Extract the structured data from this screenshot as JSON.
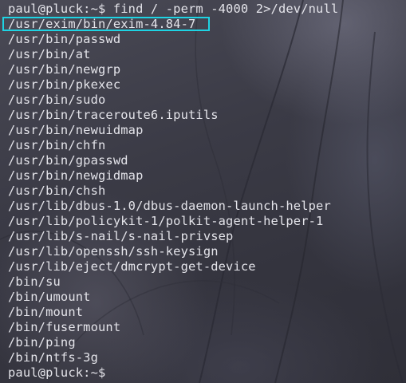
{
  "terminal": {
    "command_line": "paul@pluck:~$ find / -perm -4000 2>/dev/null",
    "highlighted_result": "/usr/exim/bin/exim-4.84-7",
    "results": [
      "/usr/bin/passwd",
      "/usr/bin/at",
      "/usr/bin/newgrp",
      "/usr/bin/pkexec",
      "/usr/bin/sudo",
      "/usr/bin/traceroute6.iputils",
      "/usr/bin/newuidmap",
      "/usr/bin/chfn",
      "/usr/bin/gpasswd",
      "/usr/bin/newgidmap",
      "/usr/bin/chsh",
      "/usr/lib/dbus-1.0/dbus-daemon-launch-helper",
      "/usr/lib/policykit-1/polkit-agent-helper-1",
      "/usr/lib/s-nail/s-nail-privsep",
      "/usr/lib/openssh/ssh-keysign",
      "/usr/lib/eject/dmcrypt-get-device",
      "/bin/su",
      "/bin/umount",
      "/bin/mount",
      "/bin/fusermount",
      "/bin/ping",
      "/bin/ntfs-3g"
    ],
    "final_prompt": "paul@pluck:~$",
    "highlight_color": "#1ed3e3",
    "text_color": "#e4e4ea"
  }
}
